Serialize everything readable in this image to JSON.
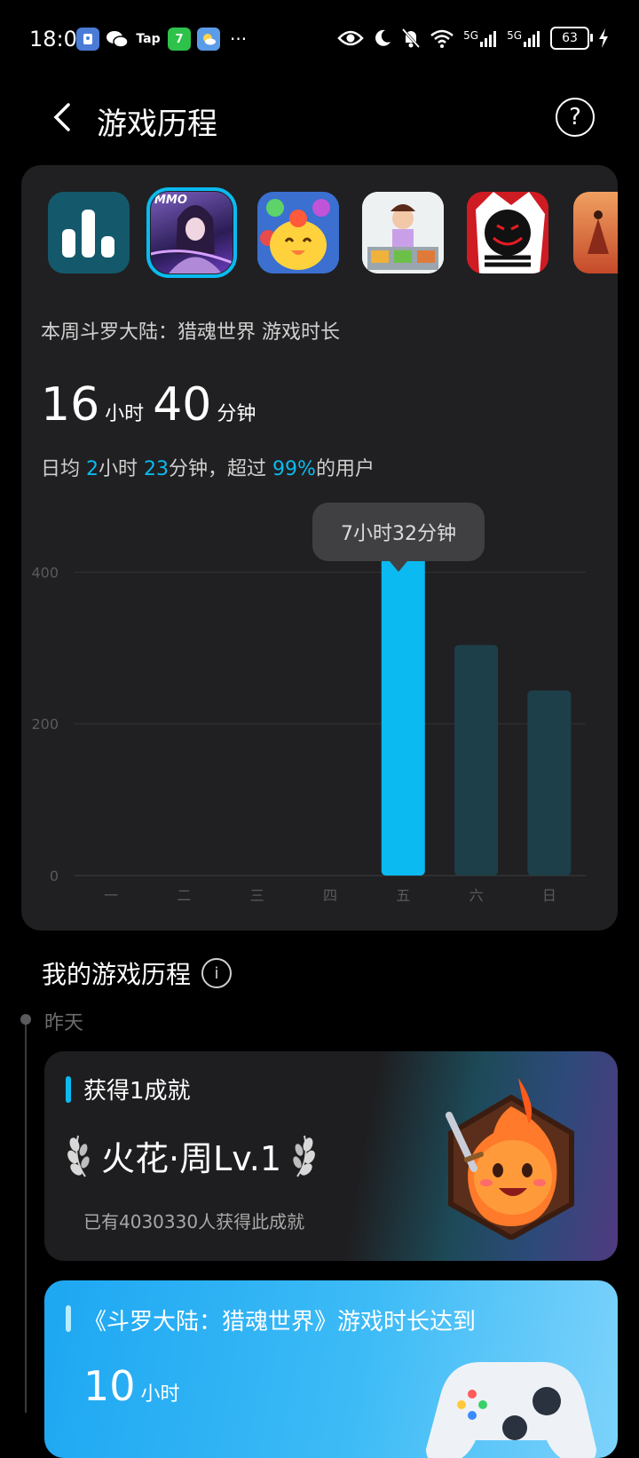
{
  "status_bar": {
    "time": "18:06",
    "apps": [
      {
        "name": "vpn-app",
        "label": "",
        "color": "#4a7bd6"
      },
      {
        "name": "wechat",
        "label": "",
        "color": "#000000"
      },
      {
        "name": "taptap",
        "label": "Tap",
        "color": "#000000"
      },
      {
        "name": "seven",
        "label": "7",
        "color": "#2ec24a"
      },
      {
        "name": "weather",
        "label": "",
        "color": "#5b9ce8"
      }
    ],
    "more": "···",
    "network1": "5G",
    "network2": "5G",
    "battery": "63"
  },
  "header": {
    "title": "游戏历程",
    "help": "?"
  },
  "games": [
    {
      "name": "stats",
      "selected": false
    },
    {
      "name": "douluo-dalu",
      "selected": true,
      "badge": "MMO"
    },
    {
      "name": "chick-puzzle",
      "selected": false
    },
    {
      "name": "cooking-game",
      "selected": false
    },
    {
      "name": "red-black-game",
      "selected": false
    },
    {
      "name": "sky-game",
      "selected": false
    }
  ],
  "summary": {
    "week_prefix": "本周",
    "game_name": "斗罗大陆：猎魂世界",
    "week_suffix": "游戏时长",
    "total_hours": "16",
    "hours_unit": "小时",
    "total_minutes": "40",
    "minutes_unit": "分钟",
    "avg_prefix": "日均",
    "avg_hours": "2",
    "avg_hours_unit": "小时",
    "avg_minutes": "23",
    "avg_minutes_unit": "分钟，超过",
    "percent": "99%",
    "avg_suffix": "的用户"
  },
  "chart_data": {
    "type": "bar",
    "categories": [
      "一",
      "二",
      "三",
      "四",
      "五",
      "六",
      "日"
    ],
    "values": [
      0,
      0,
      0,
      0,
      452,
      304,
      244
    ],
    "yticks": [
      0,
      200,
      400
    ],
    "ylim": [
      0,
      480
    ],
    "selected_index": 4,
    "tooltip": "7小时32分钟",
    "colors": {
      "selected": "#0abaf0",
      "normal": "#1d3f4a",
      "grid": "#333336",
      "label": "#5a5a5e"
    }
  },
  "history": {
    "section_title": "我的游戏历程",
    "info": "i",
    "day_label": "昨天",
    "achievement": {
      "title": "获得1成就",
      "name": "火花·周Lv.1",
      "subtitle": "已有4030330人获得此成就"
    },
    "playtime_card": {
      "title": "《斗罗大陆：猎魂世界》游戏时长达到",
      "number": "10",
      "unit": "小时"
    }
  }
}
